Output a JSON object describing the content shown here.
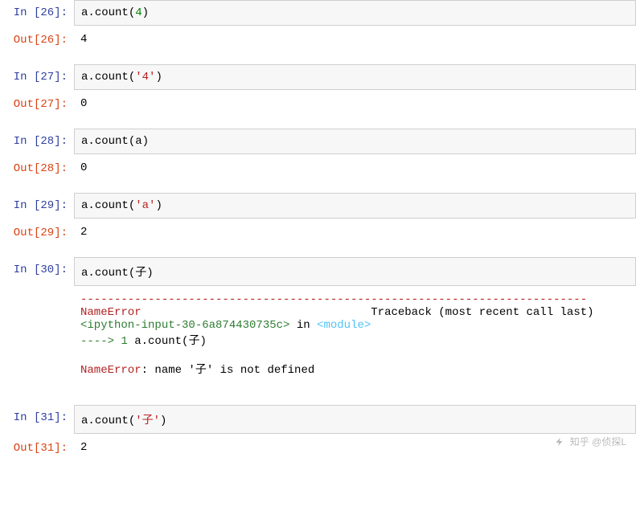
{
  "cells": [
    {
      "n": 26,
      "in": "a.count(4)",
      "out": "4",
      "err": null
    },
    {
      "n": 27,
      "in": "a.count('4')",
      "out": "0",
      "err": null
    },
    {
      "n": 28,
      "in": "a.count(a)",
      "out": "0",
      "err": null
    },
    {
      "n": 29,
      "in": "a.count('a')",
      "out": "2",
      "err": null
    },
    {
      "n": 30,
      "in": "a.count(子)",
      "out": null,
      "err": {
        "sep": "---------------------------------------------------------------------------",
        "name": "NameError",
        "trace_label": "Traceback (most recent call last)",
        "ipin": "<ipython-input-30-6a874430735c>",
        "in_word": "in",
        "module": "<module>",
        "arrow": "----> 1",
        "code": "a.count(子)",
        "msg_prefix": "NameError",
        "msg_rest": ": name '子' is not defined"
      }
    },
    {
      "n": 31,
      "in": "a.count('子')",
      "out": "2",
      "err": null
    }
  ],
  "watermark": "知乎 @侦探L"
}
